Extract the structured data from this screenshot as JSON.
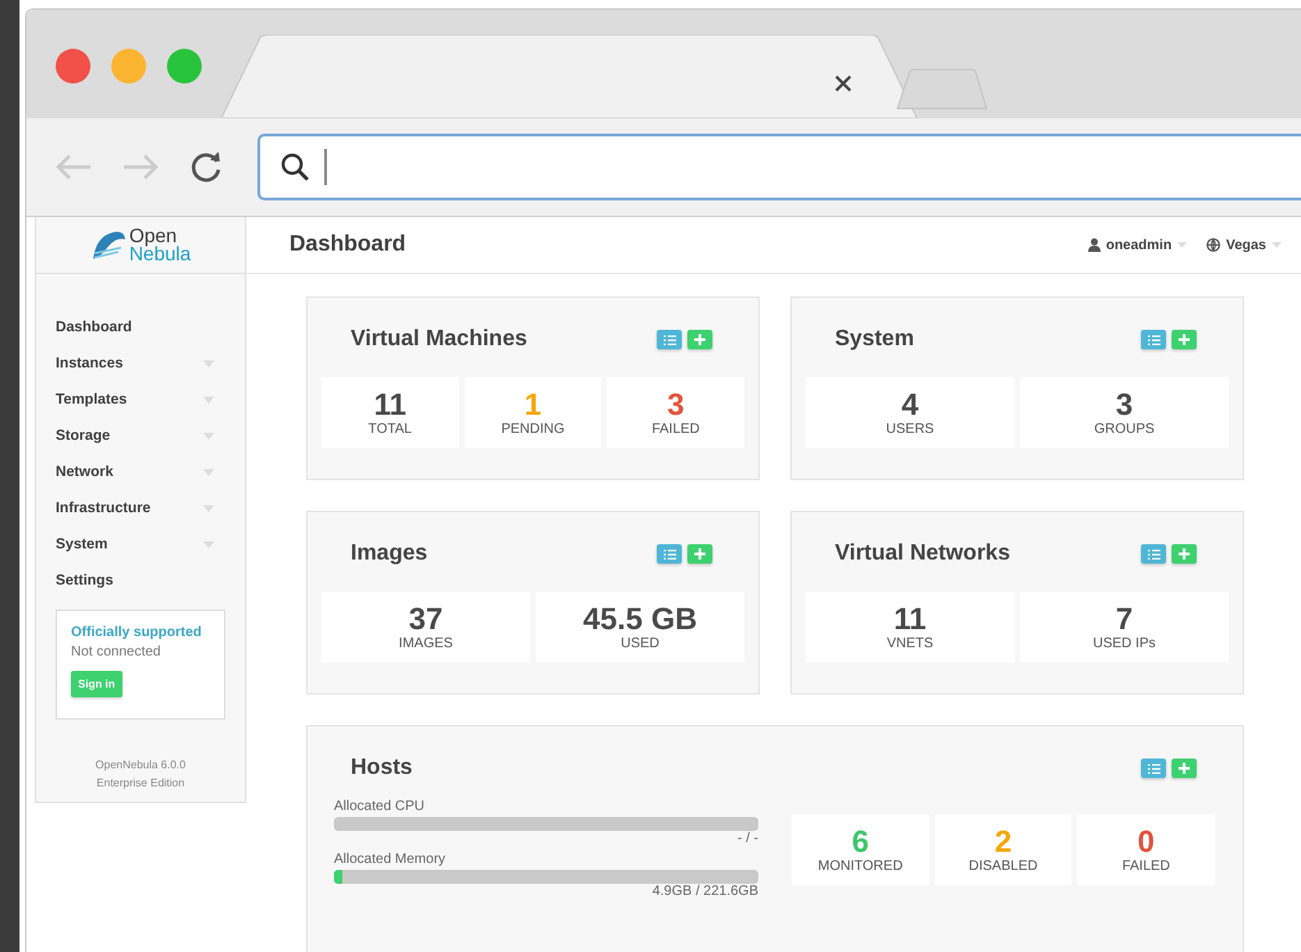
{
  "app": {
    "logo": {
      "line1": "Open",
      "line2": "Nebula"
    },
    "page_title": "Dashboard",
    "user": "oneadmin",
    "zone": "Vegas"
  },
  "sidebar": {
    "items": [
      {
        "label": "Dashboard",
        "expandable": false
      },
      {
        "label": "Instances",
        "expandable": true
      },
      {
        "label": "Templates",
        "expandable": true
      },
      {
        "label": "Storage",
        "expandable": true
      },
      {
        "label": "Network",
        "expandable": true
      },
      {
        "label": "Infrastructure",
        "expandable": true
      },
      {
        "label": "System",
        "expandable": true
      },
      {
        "label": "Settings",
        "expandable": false
      }
    ],
    "support": {
      "title": "Officially supported",
      "status": "Not connected",
      "button": "Sign in"
    },
    "version": "OpenNebula 6.0.0",
    "edition": "Enterprise Edition"
  },
  "cards": [
    {
      "title": "Virtual Machines",
      "stats": [
        {
          "value": "11",
          "label": "TOTAL",
          "color": "#4a4a4a"
        },
        {
          "value": "1",
          "label": "PENDING",
          "color": "#f5a60a"
        },
        {
          "value": "3",
          "label": "FAILED",
          "color": "#e2533d"
        }
      ]
    },
    {
      "title": "System",
      "stats": [
        {
          "value": "4",
          "label": "USERS",
          "color": "#4a4a4a"
        },
        {
          "value": "3",
          "label": "GROUPS",
          "color": "#4a4a4a"
        }
      ]
    },
    {
      "title": "Images",
      "stats": [
        {
          "value": "37",
          "label": "IMAGES",
          "color": "#4a4a4a"
        },
        {
          "value": "45.5 GB",
          "label": "USED",
          "color": "#4a4a4a"
        }
      ]
    },
    {
      "title": "Virtual Networks",
      "stats": [
        {
          "value": "11",
          "label": "VNETS",
          "color": "#4a4a4a"
        },
        {
          "value": "7",
          "label": "USED IPs",
          "color": "#4a4a4a"
        }
      ]
    }
  ],
  "hosts": {
    "title": "Hosts",
    "meters": [
      {
        "label": "Allocated CPU",
        "level": 0,
        "reading": "- / -"
      },
      {
        "label": "Allocated Memory",
        "level": 0.02,
        "reading": "4.9GB / 221.6GB"
      }
    ],
    "stats": [
      {
        "value": "6",
        "label": "MONITORED",
        "color": "#3cc76a"
      },
      {
        "value": "2",
        "label": "DISABLED",
        "color": "#f5a60a"
      },
      {
        "value": "0",
        "label": "FAILED",
        "color": "#e2533d"
      }
    ]
  }
}
